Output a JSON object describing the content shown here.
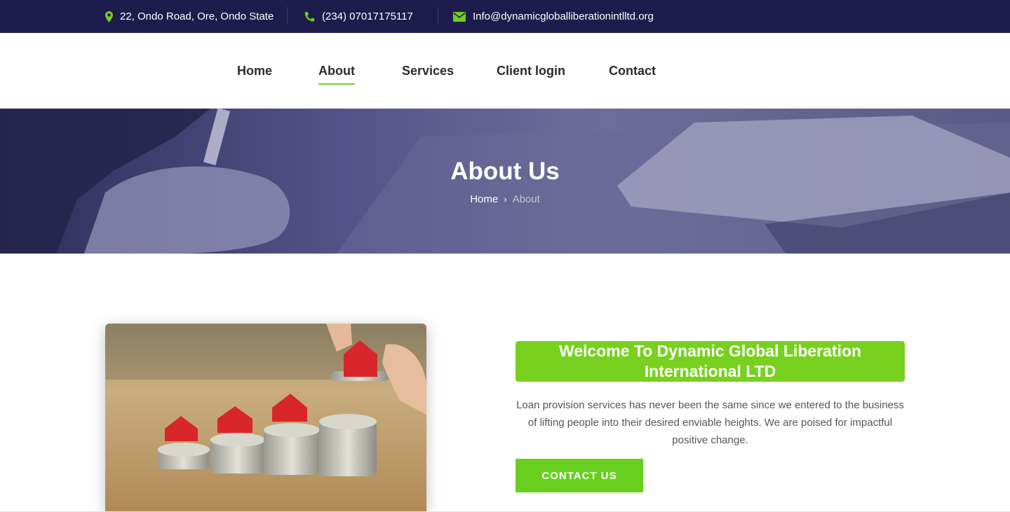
{
  "topbar": {
    "address": "22, Ondo Road, Ore, Ondo State",
    "phone": "(234) 07017175117",
    "email": "Info@dynamicgloballiberationintlltd.org",
    "icon_color": "#6fcf1f",
    "icons": [
      "map-marker-icon",
      "phone-icon",
      "envelope-icon"
    ]
  },
  "nav": {
    "items": [
      {
        "label": "Home"
      },
      {
        "label": "About"
      },
      {
        "label": "Services"
      },
      {
        "label": "Client login"
      },
      {
        "label": "Contact"
      }
    ],
    "active": "About"
  },
  "hero": {
    "title": "About Us",
    "breadcrumb": {
      "home": "Home",
      "current": "About"
    }
  },
  "about": {
    "welcome": "Welcome To Dynamic Global Liberation International LTD",
    "description": "Loan provision services has never been the same since we entered to the business of lifting people into their desired enviable heights. We are poised for impactful positive change.",
    "button_label": "CONTACT US"
  },
  "colors": {
    "accent": "#78d11e",
    "topbar_bg": "#1e1c4d"
  }
}
